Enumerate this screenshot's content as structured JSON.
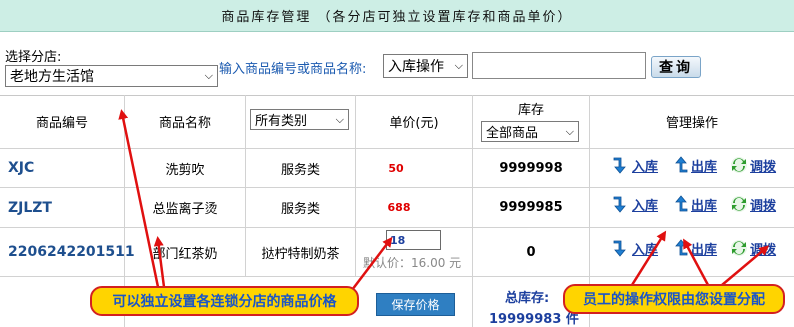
{
  "header": {
    "title": "商品库存管理 （各分店可独立设置库存和商品单价）"
  },
  "filter": {
    "shop_label": "选择分店:",
    "shop_value": "老地方生活馆",
    "search_label": "输入商品编号或商品名称:",
    "operation_value": "入库操作",
    "search_value": "",
    "query_label": "查询"
  },
  "table": {
    "columns": {
      "code": "商品编号",
      "name": "商品名称",
      "price": "单价(元)",
      "stock": "库存",
      "manage": "管理操作"
    },
    "category_filter": "所有类别",
    "stock_filter": "全部商品",
    "rows": [
      {
        "code": "XJC",
        "name": "洗剪吹",
        "category": "服务类",
        "price": "50",
        "stock": "9999998"
      },
      {
        "code": "ZJLZT",
        "name": "总监离子烫",
        "category": "服务类",
        "price": "688",
        "stock": "9999985"
      },
      {
        "code": "2206242201511",
        "name": "部门红茶奶",
        "category": "挞柠特制奶茶",
        "price": "18",
        "stock": "0"
      }
    ],
    "actions": {
      "in": "入库",
      "out": "出库",
      "transfer": "调拨"
    },
    "default_price": "默认价：16.00 元",
    "save_label": "保存价格",
    "total_label": "总库存:",
    "total_value": "19999983 件"
  },
  "callouts": {
    "left": "可以独立设置各连锁分店的商品价格",
    "right": "员工的操作权限由您设置分配"
  },
  "colors": {
    "accent": "#1c3f9e",
    "price": "#e00000",
    "callout_bg": "#ffd400",
    "callout_border": "#d32020",
    "arrow": "#e01010",
    "header_bg": "#cdeee5"
  }
}
